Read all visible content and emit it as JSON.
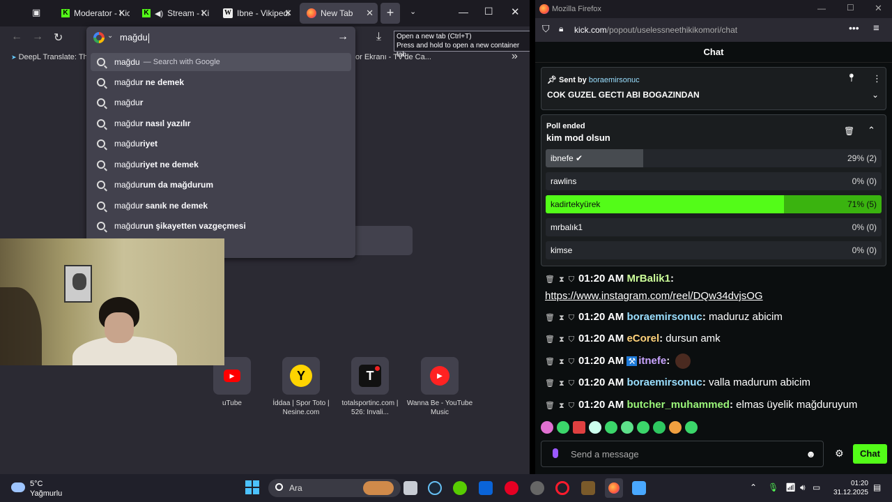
{
  "left_browser": {
    "tabs": [
      {
        "label": "Moderator - Kic",
        "close": "✕"
      },
      {
        "label": "Stream - Ki",
        "close": "✕"
      },
      {
        "label": "Ibne - Vikipedi",
        "close": "✕"
      },
      {
        "label": "New Tab",
        "close": "✕"
      }
    ],
    "new_tab_symbol": "+",
    "url_value": "mağdu",
    "tooltip_line1": "Open a new tab (Ctrl+T)",
    "tooltip_line2": "Press and hold to open a new container tab",
    "bookmark_left": "DeepL Translate: The",
    "bookmark_right": "or Ekranı - TV'de Ca...",
    "bookmark_more": "»",
    "suggestions": [
      {
        "typed": "mağdu",
        "rest": "",
        "hint": "— Search with Google"
      },
      {
        "typed": "mağdu",
        "rest": "r ne demek",
        "hint": ""
      },
      {
        "typed": "mağdu",
        "rest": "r",
        "hint": ""
      },
      {
        "typed": "mağdu",
        "rest": "r nasıl yazılır",
        "hint": ""
      },
      {
        "typed": "mağdu",
        "rest": "riyet",
        "hint": ""
      },
      {
        "typed": "mağdu",
        "rest": "riyet ne demek",
        "hint": ""
      },
      {
        "typed": "mağdu",
        "rest": "rum da mağdurum",
        "hint": ""
      },
      {
        "typed": "mağdu",
        "rest": "r sanık ne demek",
        "hint": ""
      },
      {
        "typed": "mağdu",
        "rest": "run şikayetten vazgeçmesi",
        "hint": ""
      }
    ],
    "shortcuts": [
      {
        "label": "uTube",
        "icon": "youtube-icon"
      },
      {
        "label": "İddaa | Spor Toto | Nesine.com",
        "icon": "nesine-icon"
      },
      {
        "label": "totalsportinc.com | 526: Invali...",
        "icon": "totalsport-icon"
      },
      {
        "label": "Wanna Be - YouTube Music",
        "icon": "youtube-music-icon"
      }
    ]
  },
  "right_browser": {
    "window_title": "Mozilla Firefox",
    "url_host": "kick.com",
    "url_path": "/popout/uselessneethikikomori/chat",
    "chat_title": "Chat",
    "pinned": {
      "sent_by_label": "Sent by",
      "sent_by_user": "boraemirsonuc",
      "message": "COK GUZEL GECTI ABI BOGAZINDAN"
    },
    "poll": {
      "status": "Poll ended",
      "question": "kim mod olsun",
      "options": [
        {
          "label": "ibnefe",
          "pct": "29% (2)",
          "fill": 0.29,
          "winner": false
        },
        {
          "label": "rawlins",
          "pct": "0% (0)",
          "fill": 0,
          "winner": false
        },
        {
          "label": "kadirtekyürek",
          "pct": "71% (5)",
          "fill": 0.71,
          "winner": true
        },
        {
          "label": "mrbalık1",
          "pct": "0% (0)",
          "fill": 0,
          "winner": false
        },
        {
          "label": "kimse",
          "pct": "0% (0)",
          "fill": 0,
          "winner": false
        }
      ]
    },
    "messages": [
      {
        "time": "01:20 AM",
        "user": "MrBalik1",
        "color": "#ccff99",
        "text": "https://www.instagram.com/reel/DQw34dvjsOG",
        "link": true
      },
      {
        "time": "01:20 AM",
        "user": "boraemirsonuc",
        "color": "#9adfff",
        "text": "maduruz abicim",
        "link": false
      },
      {
        "time": "01:20 AM",
        "user": "eCorel",
        "color": "#ffd27a",
        "text": "dursun amk",
        "link": false
      },
      {
        "time": "01:20 AM",
        "user": "itnefe",
        "color": "#c9a4ff",
        "text": "",
        "link": false
      },
      {
        "time": "01:20 AM",
        "user": "boraemirsonuc",
        "color": "#9adfff",
        "text": "valla madurum abicim",
        "link": false
      },
      {
        "time": "01:20 AM",
        "user": "butcher_muhammed",
        "color": "#9bf57a",
        "text": "elmas üyelik mağduruyum",
        "link": false
      }
    ],
    "input_placeholder": "Send a message",
    "send_label": "Chat"
  },
  "taskbar": {
    "temperature": "5°C",
    "condition": "Yağmurlu",
    "search_label": "Ara",
    "time": "01:20",
    "date": "31.12.2025"
  }
}
